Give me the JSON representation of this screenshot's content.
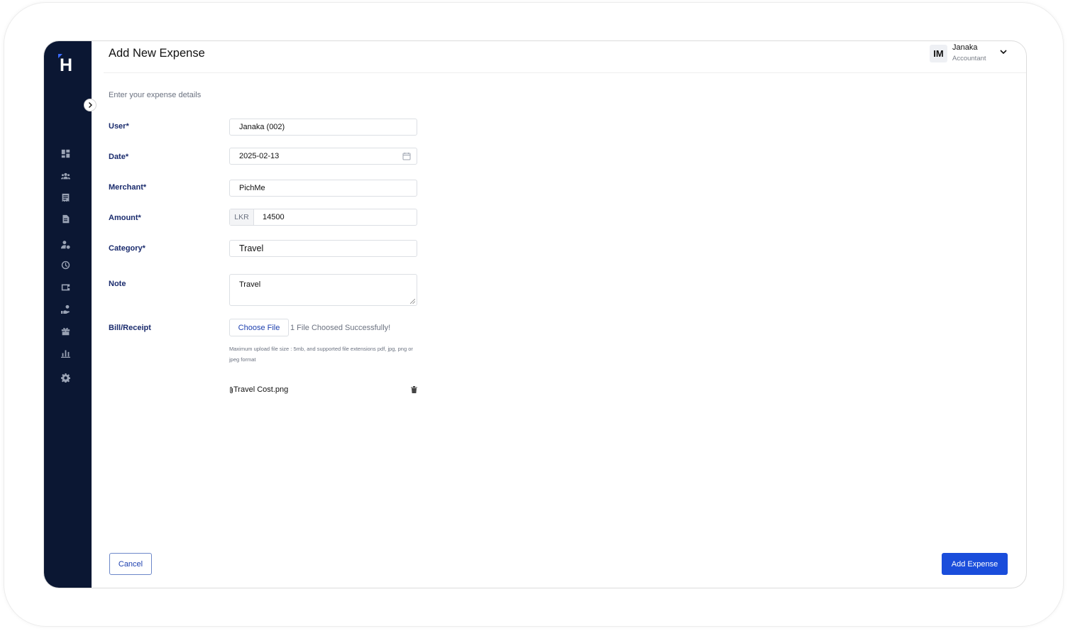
{
  "brand": {
    "logo_letter": "H"
  },
  "header": {
    "title": "Add New Expense"
  },
  "user": {
    "initials": "IM",
    "name": "Janaka",
    "role": "Accountant"
  },
  "form": {
    "subtitle": "Enter your expense details",
    "user_label": "User*",
    "user_value": "Janaka (002)",
    "date_label": "Date*",
    "date_value": "2025-02-13",
    "merchant_label": "Merchant*",
    "merchant_value": "PichMe",
    "amount_label": "Amount*",
    "amount_currency": "LKR",
    "amount_value": "14500",
    "category_label": "Category*",
    "category_value": "Travel",
    "note_label": "Note",
    "note_value": "Travel",
    "bill_label": "Bill/Receipt",
    "choose_file_label": "Choose File",
    "file_status": "1 File Choosed Successfully!",
    "upload_hint": "Maximum upload file size : 5mb, and supported file extensions pdf, jpg, png or jpeg format",
    "attached_file": "Travel Cost.png"
  },
  "actions": {
    "cancel_label": "Cancel",
    "submit_label": "Add Expense"
  },
  "sidebar_icons": [
    "dashboard-icon",
    "team-icon",
    "receipt-icon",
    "document-icon",
    "user-settings-icon",
    "clock-icon",
    "wallet-icon",
    "payment-icon",
    "gift-icon",
    "bar-chart-icon",
    "settings-icon"
  ],
  "colors": {
    "sidebar": "#0b1733",
    "primary": "#1a4ddb",
    "label": "#1a2b6d"
  }
}
